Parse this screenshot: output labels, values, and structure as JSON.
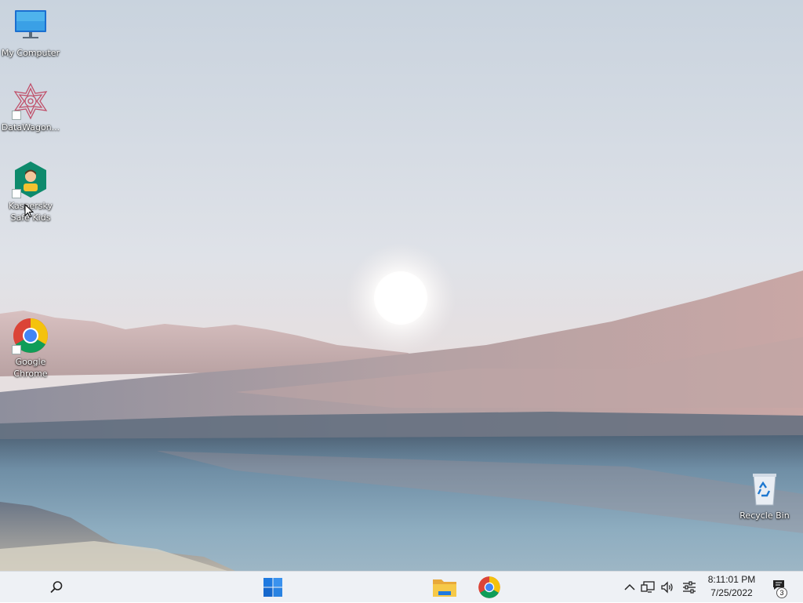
{
  "desktop": {
    "icons": [
      {
        "name": "my-computer",
        "label": "My Computer",
        "icon": "monitor-icon",
        "shortcut": false
      },
      {
        "name": "datawagon",
        "label": "DataWagon...",
        "icon": "datawagon-icon",
        "shortcut": true
      },
      {
        "name": "kaspersky",
        "label": "Kaspersky Safe Kids",
        "icon": "kaspersky-safe-kids-icon",
        "shortcut": true
      },
      {
        "name": "google-chrome",
        "label": "Google Chrome",
        "icon": "chrome-icon",
        "shortcut": true
      },
      {
        "name": "recycle-bin",
        "label": "Recycle Bin",
        "icon": "recycle-bin-icon",
        "shortcut": false
      }
    ]
  },
  "taskbar": {
    "apps": [
      {
        "name": "search",
        "icon": "search-icon"
      },
      {
        "name": "start",
        "icon": "windows-start-icon"
      },
      {
        "name": "file-explorer",
        "icon": "folder-icon"
      },
      {
        "name": "chrome",
        "icon": "chrome-icon"
      }
    ],
    "tray": {
      "icons": [
        "chevron-up-icon",
        "network-icon",
        "volume-icon",
        "settings-sliders-icon"
      ],
      "time": "8:11:01 PM",
      "date": "7/25/2022",
      "notification_count": "3"
    }
  },
  "colors": {
    "taskbar_bg": "#eef1f5",
    "start_blue": "#1f7ae0",
    "chrome_red": "#db4437",
    "chrome_yellow": "#f4c20d",
    "chrome_green": "#0f9d58",
    "chrome_blue": "#4285f4",
    "kaspersky_green": "#0e8a6c"
  }
}
